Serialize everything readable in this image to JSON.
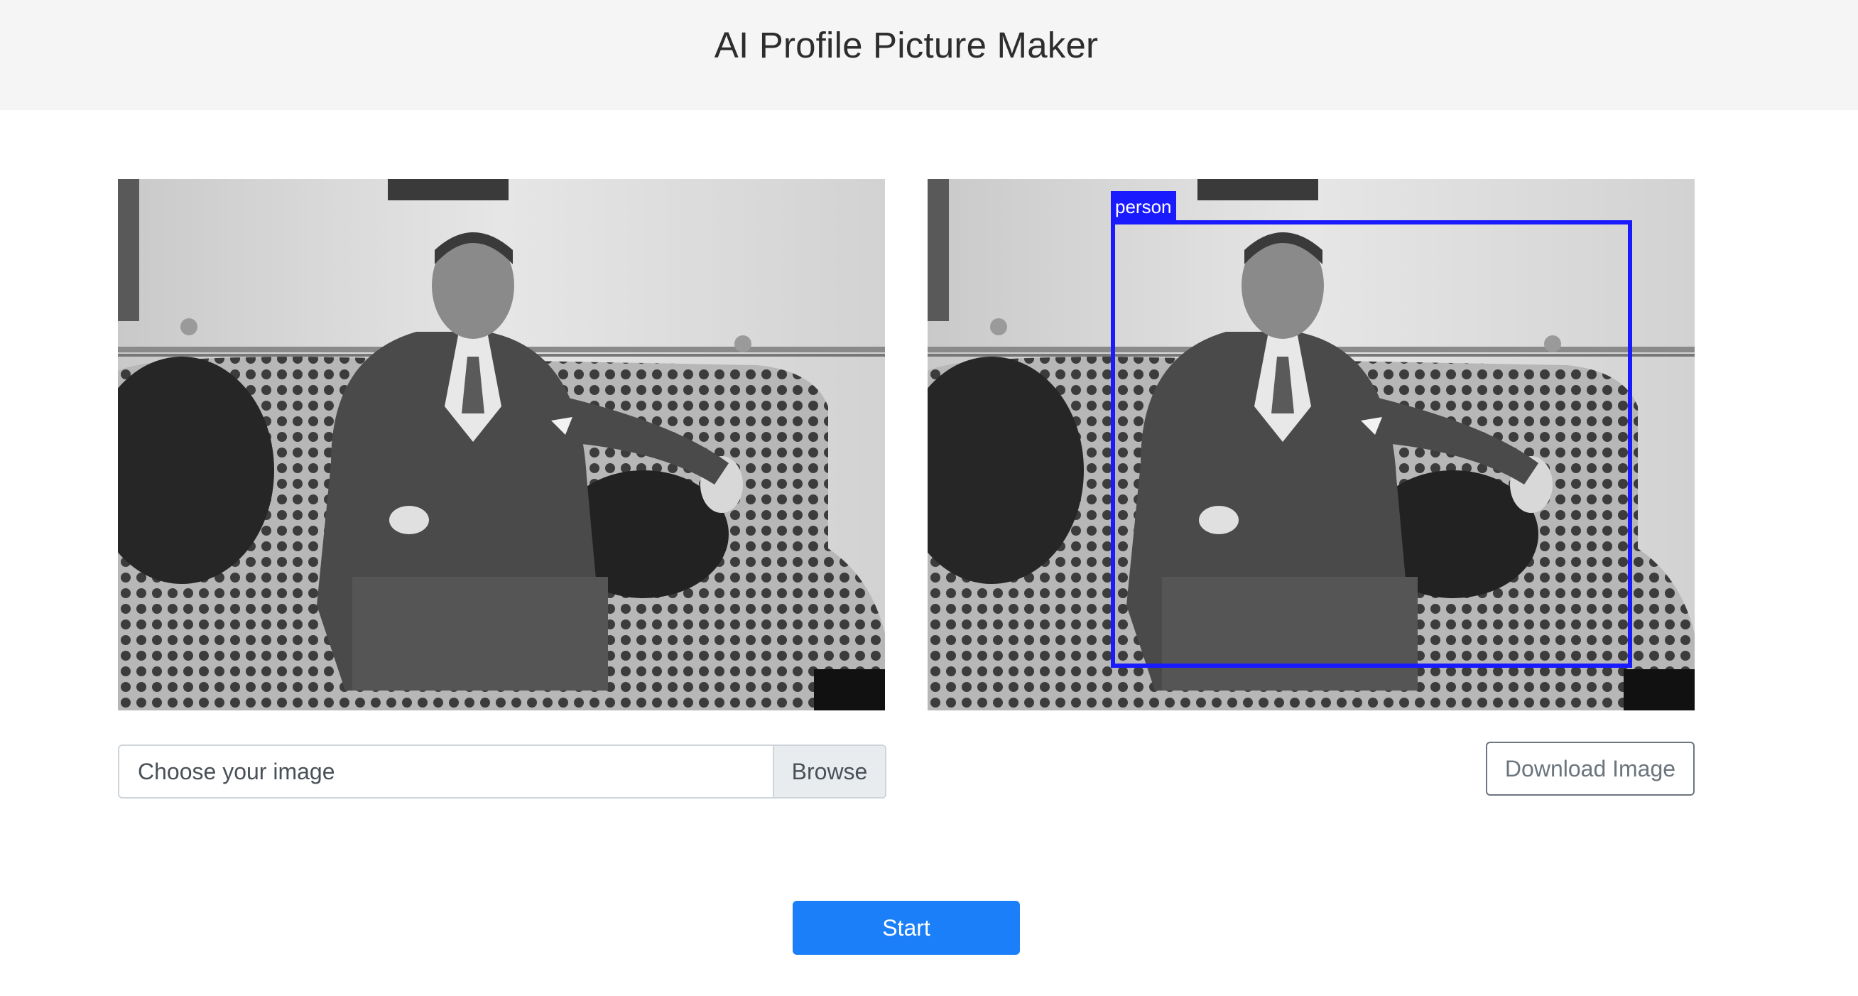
{
  "header": {
    "title": "AI Profile Picture Maker"
  },
  "original_image": {
    "subject": "photo-of-seated-man"
  },
  "result_image": {
    "detection_label": "person",
    "detection_color": "#1a1aff"
  },
  "upload": {
    "placeholder": "Choose your image",
    "browse_label": "Browse"
  },
  "actions": {
    "download_label": "Download Image",
    "start_label": "Start"
  },
  "colors": {
    "header_bg": "#f5f5f5",
    "primary": "#1a7ff8",
    "secondary": "#6c757d"
  }
}
